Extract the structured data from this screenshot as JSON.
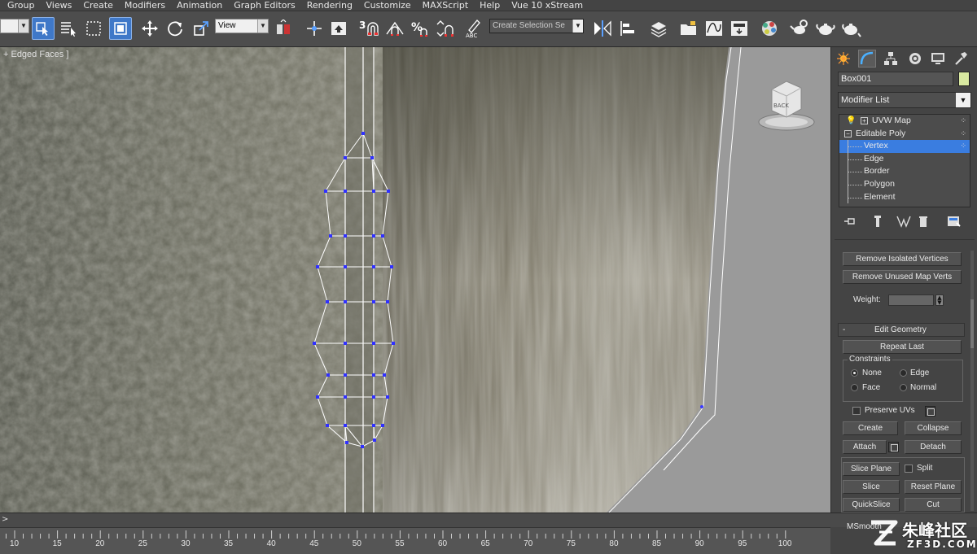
{
  "menu": [
    "Group",
    "Views",
    "Create",
    "Modifiers",
    "Animation",
    "Graph Editors",
    "Rendering",
    "Customize",
    "MAXScript",
    "Help",
    "Vue 10 xStream"
  ],
  "toolbar": {
    "ref_coord": "View",
    "selection_set": "Create Selection Se",
    "snap_number": "3"
  },
  "viewport": {
    "label": "+ Edged Faces ]",
    "viewcube_face": "BACK"
  },
  "panel": {
    "object_name": "Box001",
    "object_color": "#d8e8a0",
    "modifier_list": "Modifier List",
    "stack": [
      {
        "label": "UVW Map",
        "level": 0,
        "selected": false
      },
      {
        "label": "Editable Poly",
        "level": 0,
        "selected": false
      },
      {
        "label": "Vertex",
        "level": 1,
        "selected": true
      },
      {
        "label": "Edge",
        "level": 1,
        "selected": false
      },
      {
        "label": "Border",
        "level": 1,
        "selected": false
      },
      {
        "label": "Polygon",
        "level": 1,
        "selected": false
      },
      {
        "label": "Element",
        "level": 1,
        "selected": false
      }
    ],
    "remove_isolated": "Remove Isolated Vertices",
    "remove_unused": "Remove Unused Map Verts",
    "weight_label": "Weight:",
    "edit_geometry_sign": "-",
    "edit_geometry": "Edit Geometry",
    "repeat_last": "Repeat Last",
    "constraints": "Constraints",
    "c_none": "None",
    "c_edge": "Edge",
    "c_face": "Face",
    "c_normal": "Normal",
    "preserve_uvs": "Preserve UVs",
    "create": "Create",
    "collapse": "Collapse",
    "attach": "Attach",
    "detach": "Detach",
    "slice_plane": "Slice Plane",
    "split": "Split",
    "slice": "Slice",
    "reset_plane": "Reset Plane",
    "quickslice": "QuickSlice",
    "cut": "Cut",
    "msmooth": "MSmooth"
  },
  "timeline": {
    "arrow": ">",
    "ticks": [
      "10",
      "15",
      "20",
      "25",
      "30",
      "35",
      "40",
      "45",
      "50",
      "55",
      "60",
      "65",
      "70",
      "75",
      "80",
      "85",
      "90",
      "95",
      "100"
    ]
  },
  "watermark": {
    "text": "朱峰社区",
    "sub": "ZF3D.COM"
  }
}
